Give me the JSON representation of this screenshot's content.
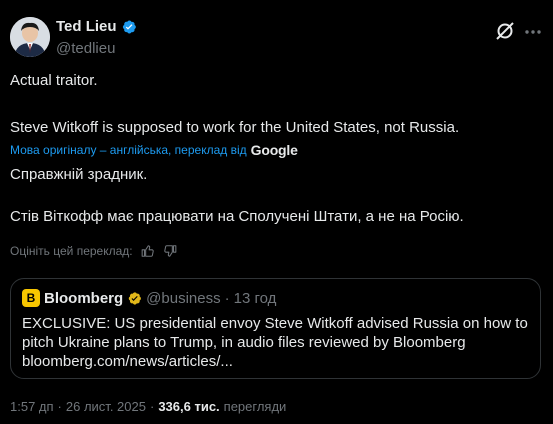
{
  "author": {
    "name": "Ted Lieu",
    "handle": "@tedlieu"
  },
  "post": {
    "line1": "Actual traitor.",
    "line2": "Steve Witkoff is supposed to work for the United States, not Russia."
  },
  "translation": {
    "note": "Мова оригіналу – англійська, переклад від",
    "provider": "Google",
    "line1": "Справжній зрадник.",
    "line2": "Стів Віткофф має працювати на Сполучені Штати, а не на Росію.",
    "rate_label": "Оцініть цей переклад:"
  },
  "quote": {
    "logo_letter": "B",
    "name": "Bloomberg",
    "handle": "@business",
    "separator": "·",
    "time": "13 год",
    "line1": "EXCLUSIVE: US presidential envoy Steve Witkoff advised Russia on how to",
    "line2": "pitch Ukraine plans to Trump, in audio files reviewed by Bloomberg",
    "line3": "bloomberg.com/news/articles/..."
  },
  "meta": {
    "time": "1:57 дп",
    "separator": "·",
    "date": "26 лист. 2025",
    "separator2": "·",
    "views_count": "336,6 тис.",
    "views_label": "перегляди"
  },
  "colors": {
    "background": "#000000",
    "text": "#e7e9ea",
    "muted": "#71767b",
    "link": "#1d9bf0",
    "verified_blue": "#1d9bf0",
    "verified_gold": "#e2b719",
    "border": "#2f3336"
  },
  "icons": {
    "verified": "verified-badge-icon",
    "grok": "grok-icon",
    "more": "more-options-icon",
    "thumbs_up": "thumbs-up-icon",
    "thumbs_down": "thumbs-down-icon"
  }
}
